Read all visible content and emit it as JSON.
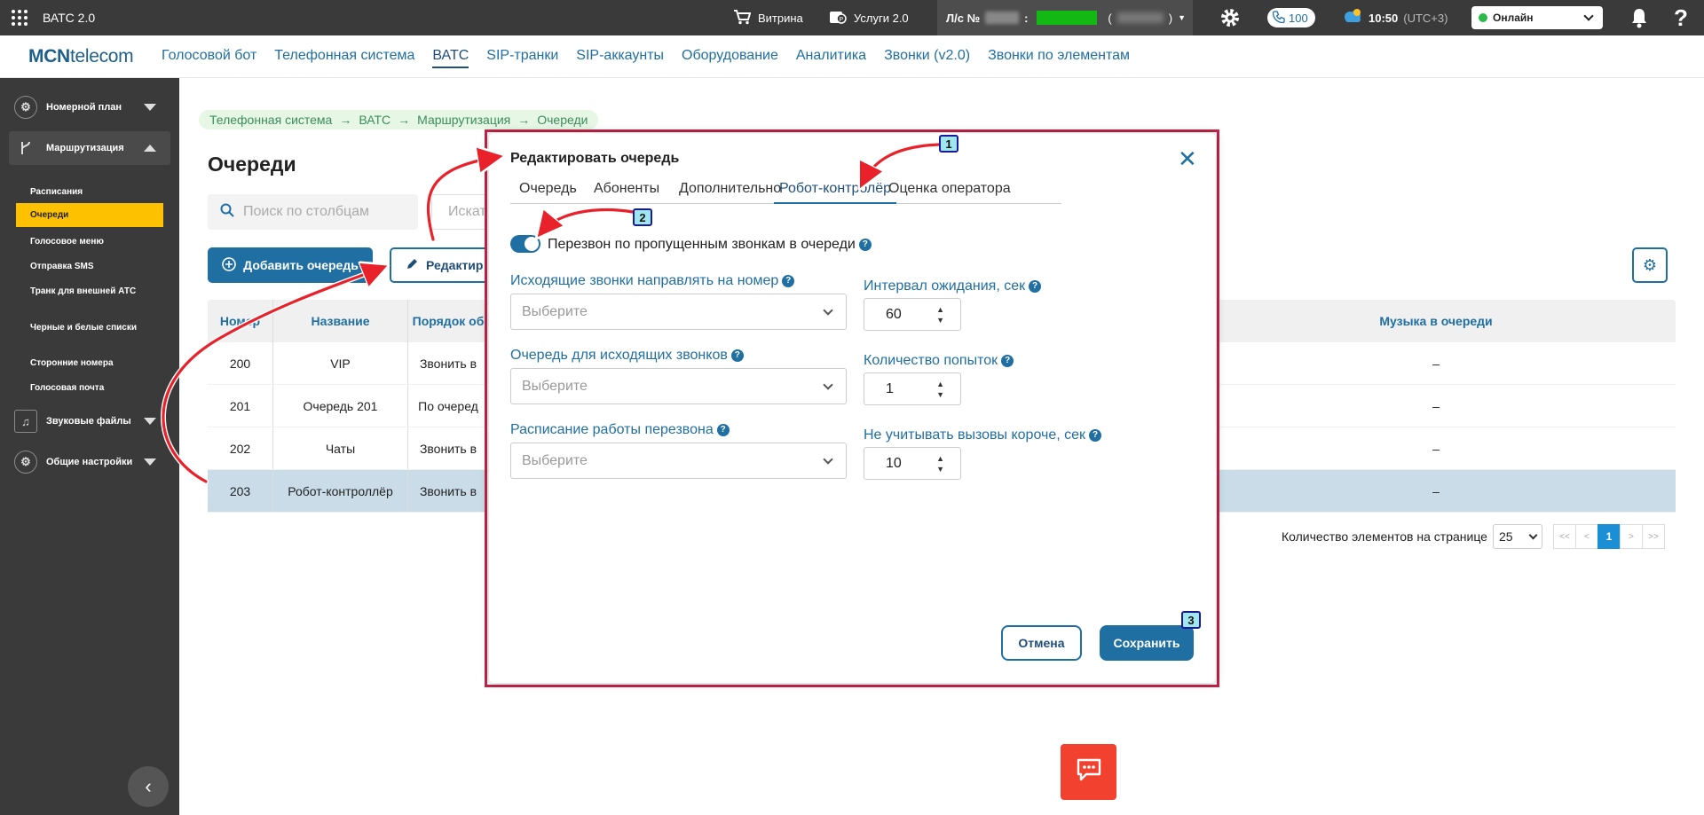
{
  "app": {
    "title": "ВАТС 2.0"
  },
  "topbar": {
    "showcase": "Витрина",
    "services": "Услуги 2.0",
    "account_label": "Л/с №",
    "account_sep": ":",
    "paren_open": "(",
    "paren_close": ")",
    "calls_count": "100",
    "time": "10:50",
    "timezone": "(UTC+3)",
    "status": "Онлайн",
    "help": "?"
  },
  "brand": {
    "logo_bold": "MCN",
    "logo_rest": "telecom"
  },
  "mainnav": [
    "Голосовой бот",
    "Телефонная система",
    "ВАТС",
    "SIP-транки",
    "SIP-аккаунты",
    "Оборудование",
    "Аналитика",
    "Звонки (v2.0)",
    "Звонки по элементам"
  ],
  "sidebar": {
    "groups": [
      "Номерной план",
      "Маршрутизация",
      "Звуковые файлы",
      "Общие настройки"
    ],
    "items": [
      "Расписания",
      "Очереди",
      "Голосовое меню",
      "Отправка SMS",
      "Транк для внешней АТС",
      "Черные и белые списки",
      "Сторонние номера",
      "Голосовая почта"
    ]
  },
  "breadcrumb": [
    "Телефонная система",
    "ВАТС",
    "Маршрутизация",
    "Очереди"
  ],
  "page": {
    "title": "Очереди",
    "search_placeholder": "Поиск по столбцам",
    "search2_placeholder": "Искать",
    "add_button": "Добавить очередь",
    "edit_button": "Редактир"
  },
  "table": {
    "headers": [
      "Номер",
      "Название",
      "Порядок об",
      "Музыка в очереди"
    ],
    "rows": [
      {
        "num": "200",
        "name": "VIP",
        "order": "Звонить в",
        "music": "–"
      },
      {
        "num": "201",
        "name": "Очередь 201",
        "order": "По очеред",
        "music": "–"
      },
      {
        "num": "202",
        "name": "Чаты",
        "order": "Звонить в",
        "music": "–"
      },
      {
        "num": "203",
        "name": "Робот-контроллёр",
        "order": "Звонить в",
        "music": "–"
      }
    ]
  },
  "pager": {
    "label": "Количество элементов на странице",
    "page_size": "25",
    "first": "<<",
    "prev": "<",
    "current": "1",
    "next": ">",
    "last": ">>"
  },
  "modal": {
    "title": "Редактировать очередь",
    "tabs": [
      "Очередь",
      "Абоненты",
      "Дополнительно",
      "Робот-контролёр",
      "Оценка оператора"
    ],
    "toggle_label": "Перезвон по пропущенным звонкам в очереди",
    "left_fields": [
      {
        "label": "Исходящие звонки направлять на номер",
        "placeholder": "Выберите"
      },
      {
        "label": "Очередь для исходящих звонков",
        "placeholder": "Выберите"
      },
      {
        "label": "Расписание работы перезвона",
        "placeholder": "Выберите"
      }
    ],
    "right_fields": [
      {
        "label": "Интервал ожидания, сек",
        "value": "60"
      },
      {
        "label": "Количество попыток",
        "value": "1"
      },
      {
        "label": "Не учитывать вызовы короче, сек",
        "value": "10"
      }
    ],
    "cancel": "Отмена",
    "save": "Сохранить",
    "help_glyph": "?"
  },
  "annotations": [
    "1",
    "2",
    "3"
  ],
  "colors": {
    "accent": "#1f6fa3",
    "active_sidebar": "#fdc100",
    "annotation_frame": "#c0244a",
    "arrow": "#e8212a"
  }
}
